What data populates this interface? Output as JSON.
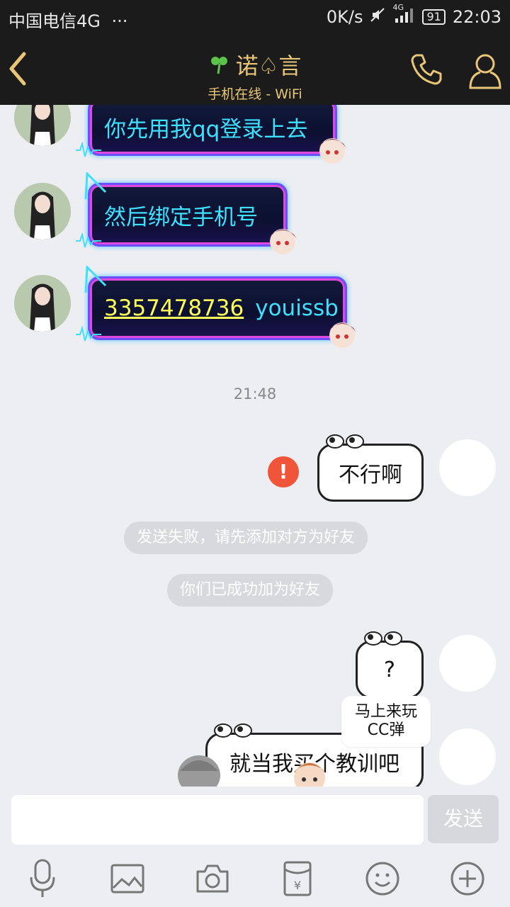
{
  "status": {
    "carrier": "中国电信4G",
    "dots": "···",
    "speed": "0K/s",
    "network": "4G",
    "battery": "91",
    "time": "22:03"
  },
  "header": {
    "title": "诺♤言",
    "subtitle": "手机在线 - WiFi"
  },
  "messages": {
    "m1": "你先用我qq登录上去",
    "m2": "然后绑定手机号",
    "m3_number": "3357478736",
    "m3_text": "youissb",
    "time_sep": "21:48",
    "m4": "不行啊",
    "sys1": "发送失败，请先添加对方为好友",
    "sys2": "你们已成功加为好友",
    "m5": "?",
    "popup": "马上来玩CC弹",
    "m6": "就当我买个教训吧"
  },
  "input": {
    "placeholder": "",
    "send_label": "发送"
  },
  "colors": {
    "accent": "#e9c677",
    "fail": "#f0553a",
    "neon_text": "#3ee0ff"
  }
}
